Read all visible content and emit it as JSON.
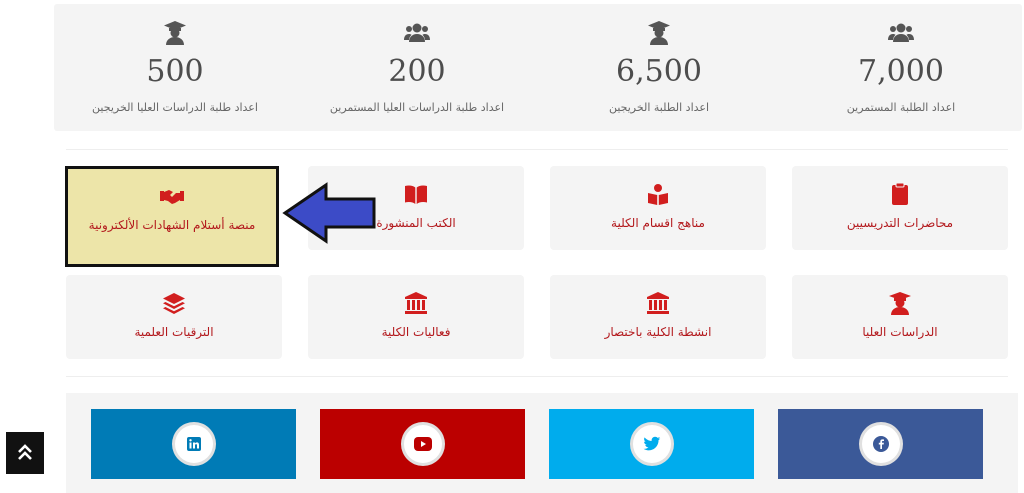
{
  "stats": [
    {
      "value": "7,000",
      "label": "اعداد الطلبة المستمرين",
      "icon": "users-icon"
    },
    {
      "value": "6,500",
      "label": "اعداد الطلبة الخريجين",
      "icon": "graduate-icon"
    },
    {
      "value": "200",
      "label": "اعداد طلبة الدراسات العليا المستمرين",
      "icon": "users-icon"
    },
    {
      "value": "500",
      "label": "اعداد طلبة الدراسات العليا الخريجين",
      "icon": "graduate-icon"
    }
  ],
  "tiles": {
    "lectures": "محاضرات التدريسيين",
    "curricula": "مناهج اقسام الكلية",
    "books": "الكتب المنشورة",
    "certificates": "منصة أستلام الشهادات الألكترونية",
    "postgrad": "الدراسات العليا",
    "activities": "انشطة الكلية باختصار",
    "events": "فعاليات الكلية",
    "promotions": "الترقيات العلمية"
  },
  "social": [
    {
      "name": "facebook",
      "color": "#3b5998"
    },
    {
      "name": "twitter",
      "color": "#00aced"
    },
    {
      "name": "youtube",
      "color": "#bb0000"
    },
    {
      "name": "linkedin",
      "color": "#007bb6"
    }
  ],
  "colors": {
    "accent": "#d11e1e",
    "label": "#b3191d",
    "highlight": "#ede5a9",
    "arrow": "#3c4bc7"
  }
}
